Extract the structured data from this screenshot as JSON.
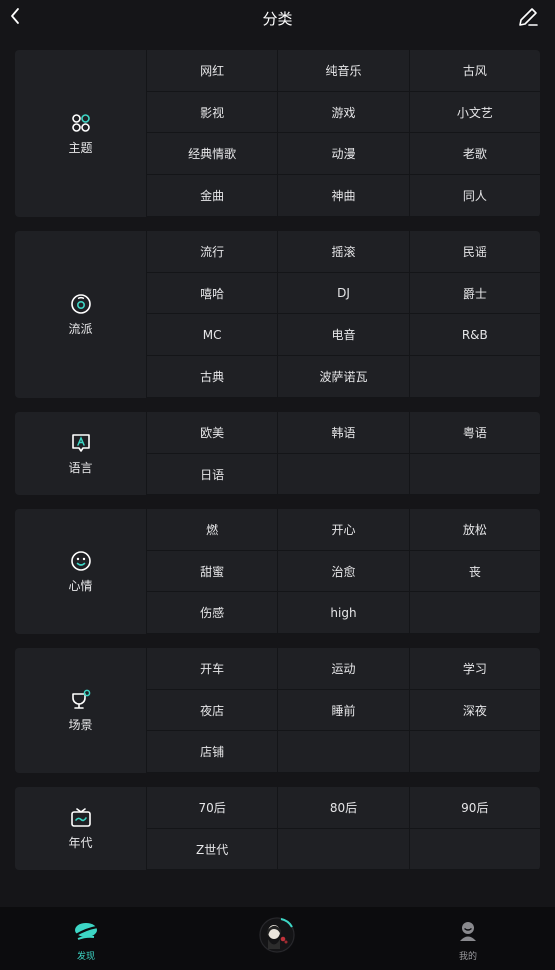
{
  "header": {
    "title": "分类"
  },
  "colors": {
    "accent": "#3dd6c5",
    "background": "#151518",
    "panel": "#1f2024"
  },
  "sections": [
    {
      "label": "主题",
      "icon": "grid-circles-icon",
      "items": [
        "网红",
        "纯音乐",
        "古风",
        "影视",
        "游戏",
        "小文艺",
        "经典情歌",
        "动漫",
        "老歌",
        "金曲",
        "神曲",
        "同人"
      ]
    },
    {
      "label": "流派",
      "icon": "disc-icon",
      "items": [
        "流行",
        "摇滚",
        "民谣",
        "嘻哈",
        "DJ",
        "爵士",
        "MC",
        "电音",
        "R&B",
        "古典",
        "波萨诺瓦"
      ]
    },
    {
      "label": "语言",
      "icon": "language-bubble-icon",
      "items": [
        "欧美",
        "韩语",
        "粤语",
        "日语"
      ]
    },
    {
      "label": "心情",
      "icon": "smiley-icon",
      "items": [
        "燃",
        "开心",
        "放松",
        "甜蜜",
        "治愈",
        "丧",
        "伤感",
        "high"
      ]
    },
    {
      "label": "场景",
      "icon": "cup-icon",
      "items": [
        "开车",
        "运动",
        "学习",
        "夜店",
        "睡前",
        "深夜",
        "店铺"
      ]
    },
    {
      "label": "年代",
      "icon": "tv-icon",
      "items": [
        "70后",
        "80后",
        "90后",
        "Z世代"
      ]
    }
  ],
  "tabbar": {
    "discover": "发现",
    "mine": "我的"
  }
}
